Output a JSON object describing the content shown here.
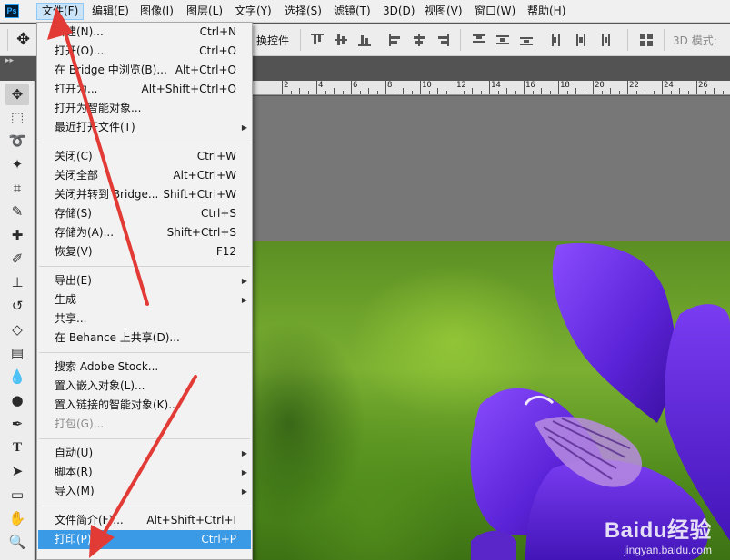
{
  "app": {
    "logo_text": "Ps"
  },
  "menubar": {
    "items": [
      "文件(F)",
      "编辑(E)",
      "图像(I)",
      "图层(L)",
      "文字(Y)",
      "选择(S)",
      "滤镜(T)",
      "3D(D)",
      "视图(V)",
      "窗口(W)",
      "帮助(H)"
    ]
  },
  "options_bar": {
    "transform_controls_label": "换控件",
    "threed_mode_label": "3D 模式:"
  },
  "ruler": {
    "ticks": [
      "2",
      "4",
      "6",
      "8",
      "10",
      "12",
      "14",
      "16",
      "18",
      "20",
      "22",
      "24",
      "26"
    ]
  },
  "file_menu": {
    "items": [
      {
        "label": "新建(N)...",
        "shortcut": "Ctrl+N"
      },
      {
        "label": "打开(O)...",
        "shortcut": "Ctrl+O"
      },
      {
        "label": "在 Bridge 中浏览(B)...",
        "shortcut": "Alt+Ctrl+O"
      },
      {
        "label": "打开为...",
        "shortcut": "Alt+Shift+Ctrl+O"
      },
      {
        "label": "打开为智能对象...",
        "shortcut": ""
      },
      {
        "label": "最近打开文件(T)",
        "shortcut": "",
        "submenu": true
      },
      {
        "label": "关闭(C)",
        "shortcut": "Ctrl+W"
      },
      {
        "label": "关闭全部",
        "shortcut": "Alt+Ctrl+W"
      },
      {
        "label": "关闭并转到 Bridge...",
        "shortcut": "Shift+Ctrl+W"
      },
      {
        "label": "存储(S)",
        "shortcut": "Ctrl+S"
      },
      {
        "label": "存储为(A)...",
        "shortcut": "Shift+Ctrl+S"
      },
      {
        "label": "恢复(V)",
        "shortcut": "F12"
      },
      {
        "label": "导出(E)",
        "shortcut": "",
        "submenu": true
      },
      {
        "label": "生成",
        "shortcut": "",
        "submenu": true
      },
      {
        "label": "共享...",
        "shortcut": ""
      },
      {
        "label": "在 Behance 上共享(D)...",
        "shortcut": ""
      },
      {
        "label": "搜索 Adobe Stock...",
        "shortcut": ""
      },
      {
        "label": "置入嵌入对象(L)...",
        "shortcut": ""
      },
      {
        "label": "置入链接的智能对象(K)...",
        "shortcut": ""
      },
      {
        "label": "打包(G)...",
        "shortcut": "",
        "disabled": true
      },
      {
        "label": "自动(U)",
        "shortcut": "",
        "submenu": true
      },
      {
        "label": "脚本(R)",
        "shortcut": "",
        "submenu": true
      },
      {
        "label": "导入(M)",
        "shortcut": "",
        "submenu": true
      },
      {
        "label": "文件简介(F)...",
        "shortcut": "Alt+Shift+Ctrl+I"
      },
      {
        "label": "打印(P)...",
        "shortcut": "Ctrl+P",
        "highlighted": true
      }
    ]
  },
  "watermark": {
    "brand": "Baidu经验",
    "domain": "jingyan.baidu.com"
  },
  "colors": {
    "menu_bg": "#f2f2f2",
    "highlight": "#3a9ae6",
    "annotation_arrow": "#e23b35",
    "canvas_gray": "#777777"
  },
  "icons": [
    "move-icon",
    "marquee-icon",
    "lasso-icon",
    "magic-wand-icon",
    "crop-icon",
    "eyedropper-icon",
    "healing-brush-icon",
    "brush-icon",
    "clone-stamp-icon",
    "history-brush-icon",
    "eraser-icon",
    "gradient-icon",
    "blur-icon",
    "dodge-icon",
    "pen-icon",
    "type-icon",
    "path-selection-icon",
    "rectangle-icon",
    "hand-icon",
    "zoom-icon"
  ]
}
